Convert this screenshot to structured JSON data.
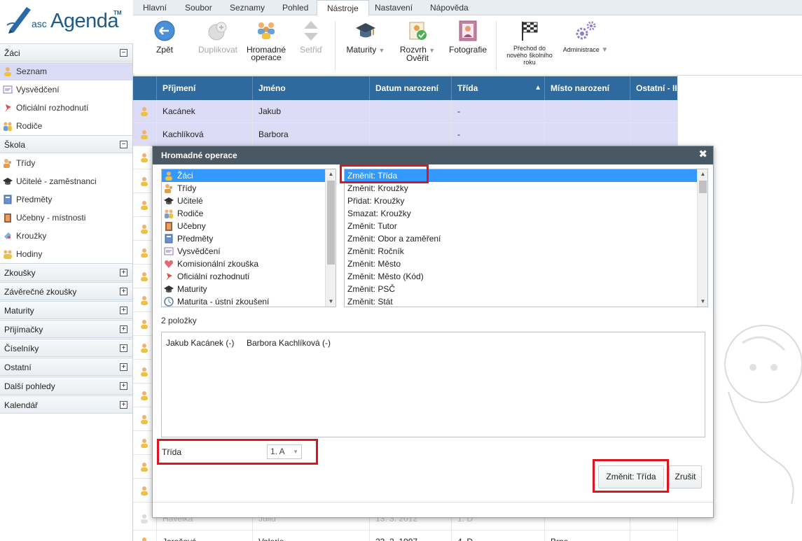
{
  "app": {
    "logo_asc": "asc",
    "logo_agenda": "Agenda",
    "logo_tm": "TM"
  },
  "menu": {
    "items": [
      {
        "label": "Hlavní"
      },
      {
        "label": "Soubor"
      },
      {
        "label": "Seznamy"
      },
      {
        "label": "Pohled"
      },
      {
        "label": "Nástroje",
        "active": true
      },
      {
        "label": "Nastavení"
      },
      {
        "label": "Nápověda"
      }
    ]
  },
  "toolbar": {
    "back": "Zpět",
    "duplicate": "Duplikovat",
    "bulk_line1": "Hromadné",
    "bulk_line2": "operace",
    "sort": "Setřiď",
    "maturity": "Maturity",
    "schedule_line1": "Rozvrh",
    "schedule_line2": "Ověřit",
    "photos": "Fotografie",
    "transition_line1": "Přechod do",
    "transition_line2": "nového školního",
    "transition_line3": "roku",
    "admin": "Administrace"
  },
  "sidebar": {
    "zaci_title": "Žáci",
    "zaci_items": [
      {
        "label": "Seznam",
        "icon": "student-icon",
        "active": true
      },
      {
        "label": "Vysvědčení",
        "icon": "certificate-icon"
      },
      {
        "label": "Oficiální rozhodnutí",
        "icon": "pin-icon"
      },
      {
        "label": "Rodiče",
        "icon": "parents-icon"
      }
    ],
    "skola_title": "Škola",
    "skola_items": [
      {
        "label": "Třídy",
        "icon": "class-icon"
      },
      {
        "label": "Učitelé - zaměstnanci",
        "icon": "graduation-cap-icon"
      },
      {
        "label": "Předměty",
        "icon": "book-icon"
      },
      {
        "label": "Učebny - místnosti",
        "icon": "door-icon"
      },
      {
        "label": "Kroužky",
        "icon": "puzzle-icon"
      },
      {
        "label": "Hodiny",
        "icon": "group-icon"
      }
    ],
    "collapsed_sections": [
      "Zkoušky",
      "Závěrečné zkoušky",
      "Maturity",
      "Přijímačky",
      "Číselníky",
      "Ostatní",
      "Další pohledy",
      "Kalendář"
    ],
    "expanded_symbol": "−",
    "collapsed_symbol": "+"
  },
  "grid": {
    "columns": [
      "Příjmení",
      "Jméno",
      "Datum narození",
      "Třída",
      "Místo narození",
      "Ostatní - II"
    ],
    "sort_indicator": "▲",
    "rows": [
      {
        "surname": "Kacánek",
        "name": "Jakub",
        "birth": "",
        "class": "-",
        "place": "",
        "selected": true
      },
      {
        "surname": "Kachlíková",
        "name": "Barbora",
        "birth": "",
        "class": "-",
        "place": "",
        "selected": true
      }
    ],
    "partial_row_surname": "Havelka",
    "partial_row_name": "Juliu",
    "partial_row_birth": "13. 3. 2012",
    "partial_row_class": "1. D",
    "last_row": {
      "surname": "Jarošová",
      "name": "Valerie",
      "birth": "23. 2. 1997",
      "class": "4. D",
      "place": "Brno"
    }
  },
  "dialog": {
    "title": "Hromadné operace",
    "close": "✖",
    "entities": [
      {
        "label": "Žáci",
        "icon": "student-icon",
        "selected": true
      },
      {
        "label": "Třídy",
        "icon": "class-icon"
      },
      {
        "label": "Učitelé",
        "icon": "graduation-cap-icon"
      },
      {
        "label": "Rodiče",
        "icon": "parents-icon"
      },
      {
        "label": "Učebny",
        "icon": "door-icon"
      },
      {
        "label": "Předměty",
        "icon": "book-icon"
      },
      {
        "label": "Vysvědčení",
        "icon": "certificate-icon"
      },
      {
        "label": "Komisionální zkouška",
        "icon": "heart-icon"
      },
      {
        "label": "Oficiální rozhodnutí",
        "icon": "pin-icon"
      },
      {
        "label": "Maturity",
        "icon": "graduation-cap-icon"
      },
      {
        "label": "Maturita - ústní zkoušení",
        "icon": "clock-icon"
      }
    ],
    "operations": [
      {
        "label": "Změnit: Třída",
        "selected": true
      },
      {
        "label": "Změnit: Kroužky"
      },
      {
        "label": "Přidat: Kroužky"
      },
      {
        "label": "Smazat: Kroužky"
      },
      {
        "label": "Změnit: Tutor"
      },
      {
        "label": "Změnit: Obor a zaměření"
      },
      {
        "label": "Změnit: Ročník"
      },
      {
        "label": "Změnit: Město"
      },
      {
        "label": "Změnit: Město (Kód)"
      },
      {
        "label": "Změnit: PSČ"
      },
      {
        "label": "Změnit: Stát"
      }
    ],
    "count_label": "2 položky",
    "selected_students": [
      "Jakub Kacánek (-)",
      "Barbora Kachlíková (-)"
    ],
    "field_label": "Třída",
    "field_value": "1. A",
    "submit": "Změnit: Třída",
    "cancel": "Zrušit"
  },
  "colors": {
    "header_blue": "#2e6a9e",
    "selection_blue": "#3399ff",
    "highlight_red": "#e0141e",
    "dialog_title": "#4a5863"
  }
}
